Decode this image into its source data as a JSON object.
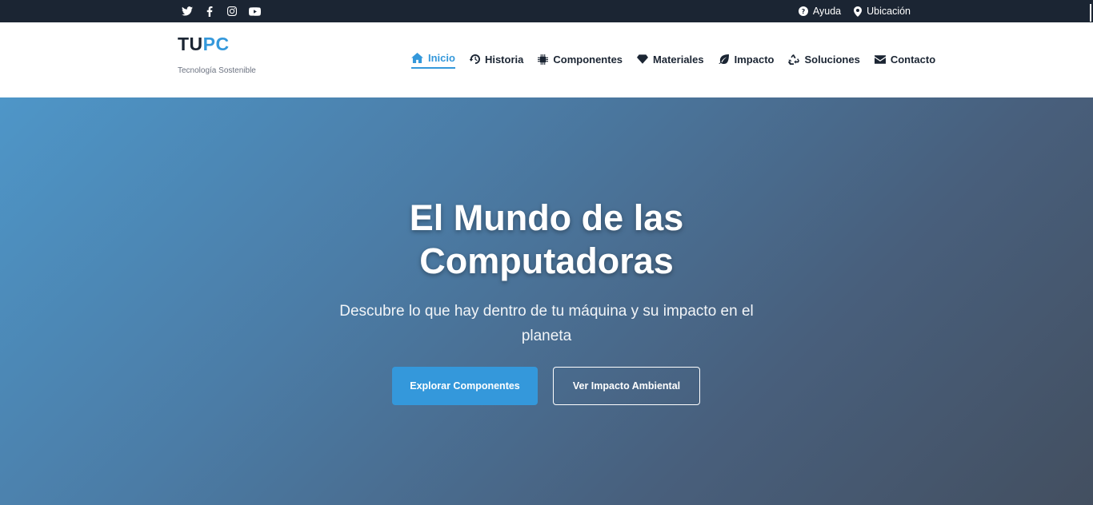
{
  "topbar": {
    "social_icons": [
      "twitter-icon",
      "facebook-icon",
      "instagram-icon",
      "youtube-icon"
    ],
    "help_label": "Ayuda",
    "location_label": "Ubicación"
  },
  "header": {
    "logo_part1": "TU",
    "logo_part2": "PC",
    "tagline": "Tecnología Sostenible",
    "nav": [
      {
        "label": "Inicio",
        "icon": "home-icon",
        "active": true
      },
      {
        "label": "Historia",
        "icon": "history-icon"
      },
      {
        "label": "Componentes",
        "icon": "chip-icon"
      },
      {
        "label": "Materiales",
        "icon": "gem-icon"
      },
      {
        "label": "Impacto",
        "icon": "leaf-icon"
      },
      {
        "label": "Soluciones",
        "icon": "recycle-icon"
      },
      {
        "label": "Contacto",
        "icon": "envelope-icon"
      }
    ]
  },
  "hero": {
    "title_line1": "El Mundo de las",
    "title_line2": "Computadoras",
    "subtitle": "Descubre lo que hay dentro de tu máquina y su impacto en el planeta",
    "primary_button": "Explorar Componentes",
    "secondary_button": "Ver Impacto Ambiental"
  },
  "colors": {
    "accent": "#3498db",
    "dark": "#1b2533"
  }
}
